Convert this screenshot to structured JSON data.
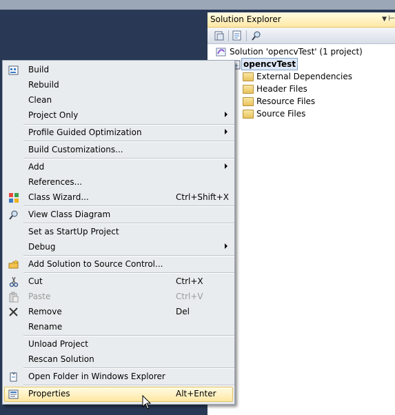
{
  "solution_explorer": {
    "title": "Solution Explorer",
    "solution_label": "Solution 'opencvTest' (1 project)",
    "project_label": "opencvTest",
    "nodes": [
      {
        "label": "External Dependencies",
        "icon": "external-dependencies-icon"
      },
      {
        "label": "Header Files",
        "icon": "folder-icon"
      },
      {
        "label": "Resource Files",
        "icon": "folder-icon"
      },
      {
        "label": "Source Files",
        "icon": "folder-icon"
      }
    ]
  },
  "context_menu": {
    "items": [
      {
        "label": "Build",
        "shortcut": "",
        "icon": "build-icon"
      },
      {
        "label": "Rebuild",
        "shortcut": ""
      },
      {
        "label": "Clean",
        "shortcut": ""
      },
      {
        "label": "Project Only",
        "shortcut": "",
        "submenu": true
      },
      {
        "label": "Profile Guided Optimization",
        "shortcut": "",
        "submenu": true
      },
      {
        "label": "Build Customizations...",
        "shortcut": ""
      },
      {
        "label": "Add",
        "shortcut": "",
        "submenu": true
      },
      {
        "label": "References...",
        "shortcut": ""
      },
      {
        "label": "Class Wizard...",
        "shortcut": "Ctrl+Shift+X",
        "icon": "class-wizard-icon"
      },
      {
        "label": "View Class Diagram",
        "shortcut": "",
        "icon": "class-diagram-icon"
      },
      {
        "label": "Set as StartUp Project",
        "shortcut": ""
      },
      {
        "label": "Debug",
        "shortcut": "",
        "submenu": true
      },
      {
        "label": "Add Solution to Source Control...",
        "shortcut": "",
        "icon": "source-control-icon"
      },
      {
        "label": "Cut",
        "shortcut": "Ctrl+X",
        "icon": "scissors-icon"
      },
      {
        "label": "Paste",
        "shortcut": "Ctrl+V",
        "icon": "paste-icon",
        "disabled": true
      },
      {
        "label": "Remove",
        "shortcut": "Del",
        "icon": "remove-x-icon"
      },
      {
        "label": "Rename",
        "shortcut": ""
      },
      {
        "label": "Unload Project",
        "shortcut": ""
      },
      {
        "label": "Rescan Solution",
        "shortcut": ""
      },
      {
        "label": "Open Folder in Windows Explorer",
        "shortcut": "",
        "icon": "open-folder-icon"
      },
      {
        "label": "Properties",
        "shortcut": "Alt+Enter",
        "icon": "properties-icon",
        "highlighted": true
      }
    ]
  },
  "colors": {
    "ide_background": "#293955",
    "menu_background": "#e9ecee",
    "highlight": "#ffe8a4"
  }
}
